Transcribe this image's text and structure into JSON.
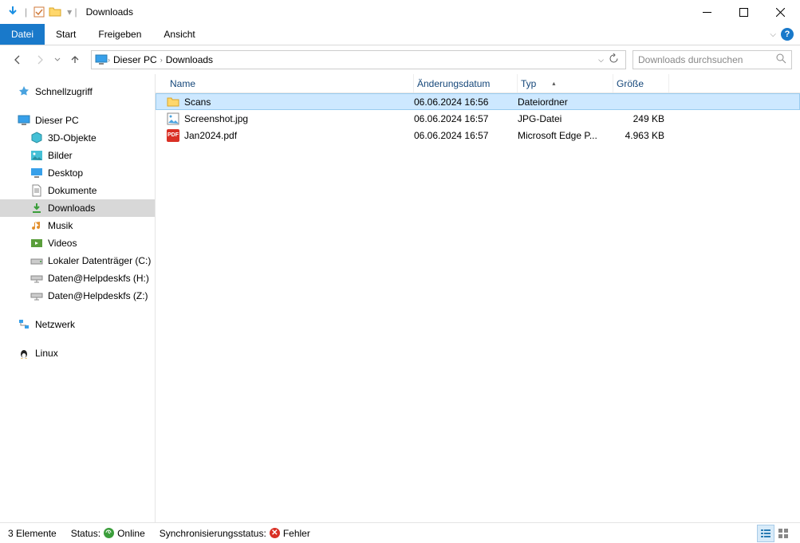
{
  "title": "Downloads",
  "ribbon": {
    "file": "Datei",
    "start": "Start",
    "share": "Freigeben",
    "view": "Ansicht"
  },
  "breadcrumb": {
    "root": "Dieser PC",
    "current": "Downloads"
  },
  "search": {
    "placeholder": "Downloads durchsuchen"
  },
  "tree": {
    "quick": "Schnellzugriff",
    "thispc": "Dieser PC",
    "children": [
      "3D-Objekte",
      "Bilder",
      "Desktop",
      "Dokumente",
      "Downloads",
      "Musik",
      "Videos",
      "Lokaler Datenträger (C:)",
      "Daten@Helpdeskfs (H:)",
      "Daten@Helpdeskfs (Z:)"
    ],
    "network": "Netzwerk",
    "linux": "Linux"
  },
  "columns": {
    "name": "Name",
    "date": "Änderungsdatum",
    "type": "Typ",
    "size": "Größe"
  },
  "files": [
    {
      "name": "Scans",
      "date": "06.06.2024 16:56",
      "type": "Dateiordner",
      "size": "",
      "icon": "folder"
    },
    {
      "name": "Screenshot.jpg",
      "date": "06.06.2024 16:57",
      "type": "JPG-Datei",
      "size": "249 KB",
      "icon": "image"
    },
    {
      "name": "Jan2024.pdf",
      "date": "06.06.2024 16:57",
      "type": "Microsoft Edge P...",
      "size": "4.963 KB",
      "icon": "pdf"
    }
  ],
  "status": {
    "count": "3 Elemente",
    "status_label": "Status:",
    "online": "Online",
    "sync_label": "Synchronisierungsstatus:",
    "error": "Fehler"
  }
}
